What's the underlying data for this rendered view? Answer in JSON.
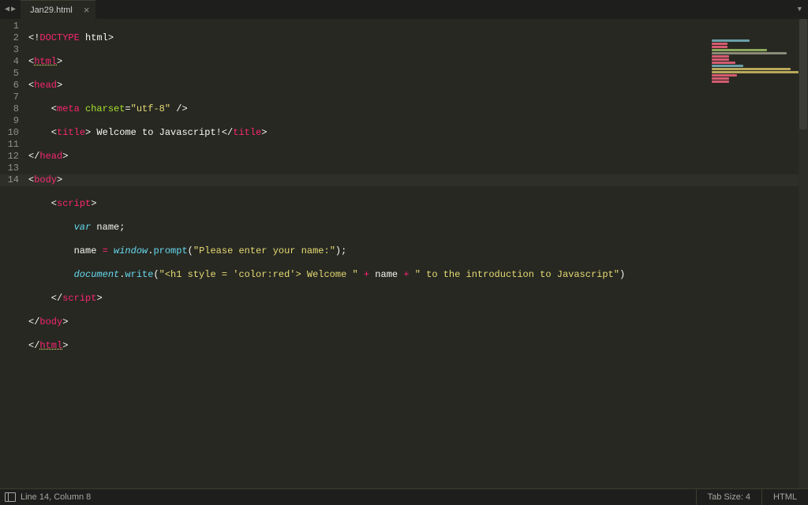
{
  "tab": {
    "filename": "Jan29.html",
    "close": "×",
    "dropdown": "▼"
  },
  "nav": {
    "back": "◀",
    "forward": "▶"
  },
  "status": {
    "cursor": "Line 14, Column 8",
    "tab_size": "Tab Size: 4",
    "syntax": "HTML"
  },
  "gutter": [
    "1",
    "2",
    "3",
    "4",
    "5",
    "6",
    "7",
    "8",
    "9",
    "10",
    "11",
    "12",
    "13",
    "14"
  ],
  "code": {
    "l1": {
      "a": "<!",
      "b": "DOCTYPE",
      "c": " html",
      "d": ">"
    },
    "l2": {
      "a": "<",
      "b": "html",
      "c": ">"
    },
    "l3": {
      "a": "<",
      "b": "head",
      "c": ">"
    },
    "l4": {
      "a": "    <",
      "b": "meta",
      "c": " ",
      "d": "charset",
      "e": "=",
      "f": "\"utf-8\"",
      "g": " />"
    },
    "l5": {
      "a": "    <",
      "b": "title",
      "c": "> Welcome to Javascript!</",
      "d": "title",
      "e": ">"
    },
    "l6": {
      "a": "</",
      "b": "head",
      "c": ">"
    },
    "l7": {
      "a": "<",
      "b": "body",
      "c": ">"
    },
    "l8": {
      "a": "    <",
      "b": "script",
      "c": ">"
    },
    "l9": {
      "a": "        ",
      "b": "var",
      "c": " name;"
    },
    "l10": {
      "a": "        name ",
      "b": "=",
      "c": " ",
      "d": "window",
      "e": ".",
      "f": "prompt",
      "g": "(",
      "h": "\"Please enter your name:\"",
      "i": ");"
    },
    "l11": {
      "a": "        ",
      "b": "document",
      "c": ".",
      "d": "write",
      "e": "(",
      "f": "\"<h1 style = 'color:red'> Welcome \"",
      "g": " ",
      "h": "+",
      "i": " name ",
      "j": "+",
      "k": " ",
      "l": "\" to the introduction to Javascript\"",
      "m": ")"
    },
    "l12": {
      "a": "    </",
      "b": "script",
      "c": ">"
    },
    "l13": {
      "a": "</",
      "b": "body",
      "c": ">"
    },
    "l14": {
      "a": "</",
      "b": "html",
      "c": ">"
    }
  }
}
